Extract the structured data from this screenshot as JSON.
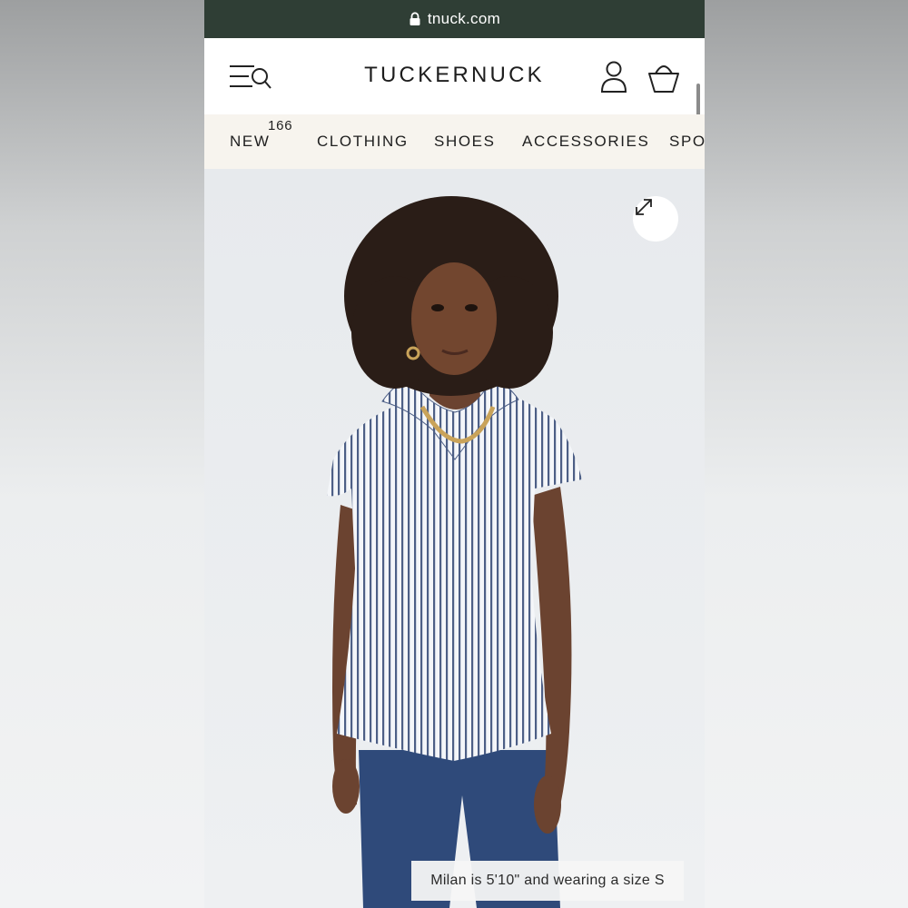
{
  "browser": {
    "url": "tnuck.com"
  },
  "header": {
    "brand": "TUCKERNUCK",
    "icons": {
      "menu": "menu-search-icon",
      "account": "account-icon",
      "bag": "shopping-bag-icon"
    }
  },
  "nav": {
    "items": [
      {
        "label": "NEW",
        "badge": "166"
      },
      {
        "label": "CLOTHING"
      },
      {
        "label": "SHOES"
      },
      {
        "label": "ACCESSORIES"
      },
      {
        "label": "SPO"
      }
    ]
  },
  "product": {
    "image_alt": "Model wearing a striped short-sleeve ruffle-collar top and jeans",
    "caption": "Milan is 5'10\" and wearing a size S",
    "expand_icon": "expand-icon"
  },
  "colors": {
    "url_bar": "#2f3e35",
    "nav_background": "#f7f4ee",
    "stripe_blue": "#4d5f86",
    "denim": "#2f4a7a"
  }
}
